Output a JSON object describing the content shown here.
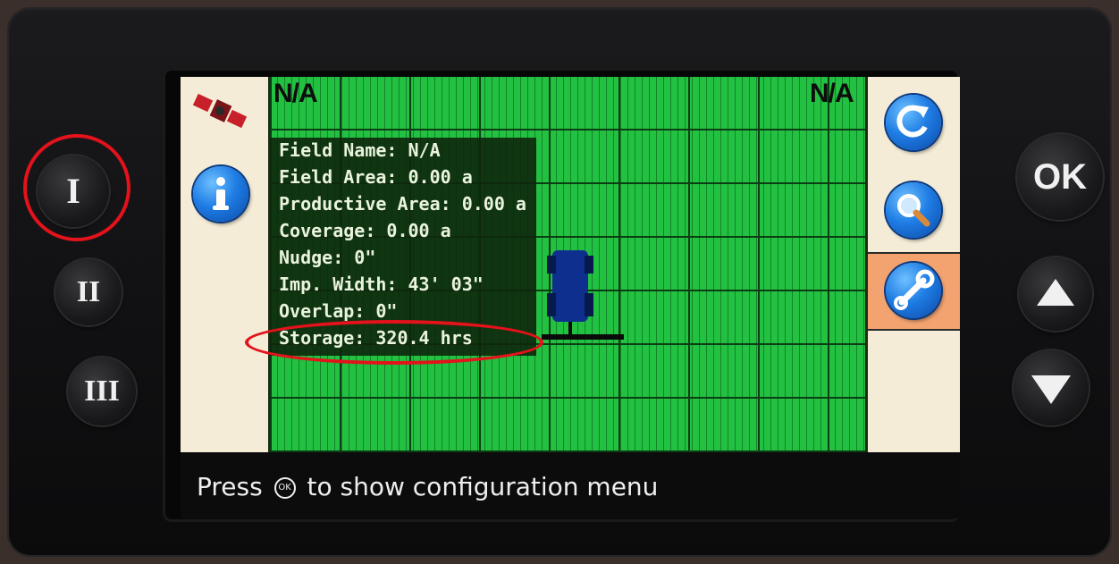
{
  "left_hardware_buttons": [
    "I",
    "II",
    "III"
  ],
  "right_hardware_buttons": {
    "ok_label": "OK",
    "up_icon": "triangle-up",
    "down_icon": "triangle-down"
  },
  "map": {
    "top_left_label": "N/A",
    "top_right_label": "N/A"
  },
  "info_panel": {
    "lines": [
      "Field Name: N/A",
      "Field Area: 0.00 a",
      "Productive Area: 0.00 a",
      "Coverage: 0.00 a",
      "Nudge: 0\"",
      "Imp. Width:  43' 03\"",
      "Overlap: 0\"",
      "Storage: 320.4 hrs"
    ]
  },
  "left_panel_icons": [
    "satellite-icon",
    "info-icon"
  ],
  "right_panel_icons": [
    "refresh-icon",
    "zoom-icon",
    "wrench-icon"
  ],
  "status_bar": {
    "prefix": "Press",
    "ok_glyph": "OK",
    "suffix": "to show configuration menu"
  },
  "colors": {
    "map_green": "#22c141",
    "panel_cream": "#f4ecd6",
    "selected_orange": "#f2a36f",
    "button_blue": "#1f7de4",
    "annotation_red": "#e3121b",
    "tractor_blue": "#0f2f8f"
  }
}
